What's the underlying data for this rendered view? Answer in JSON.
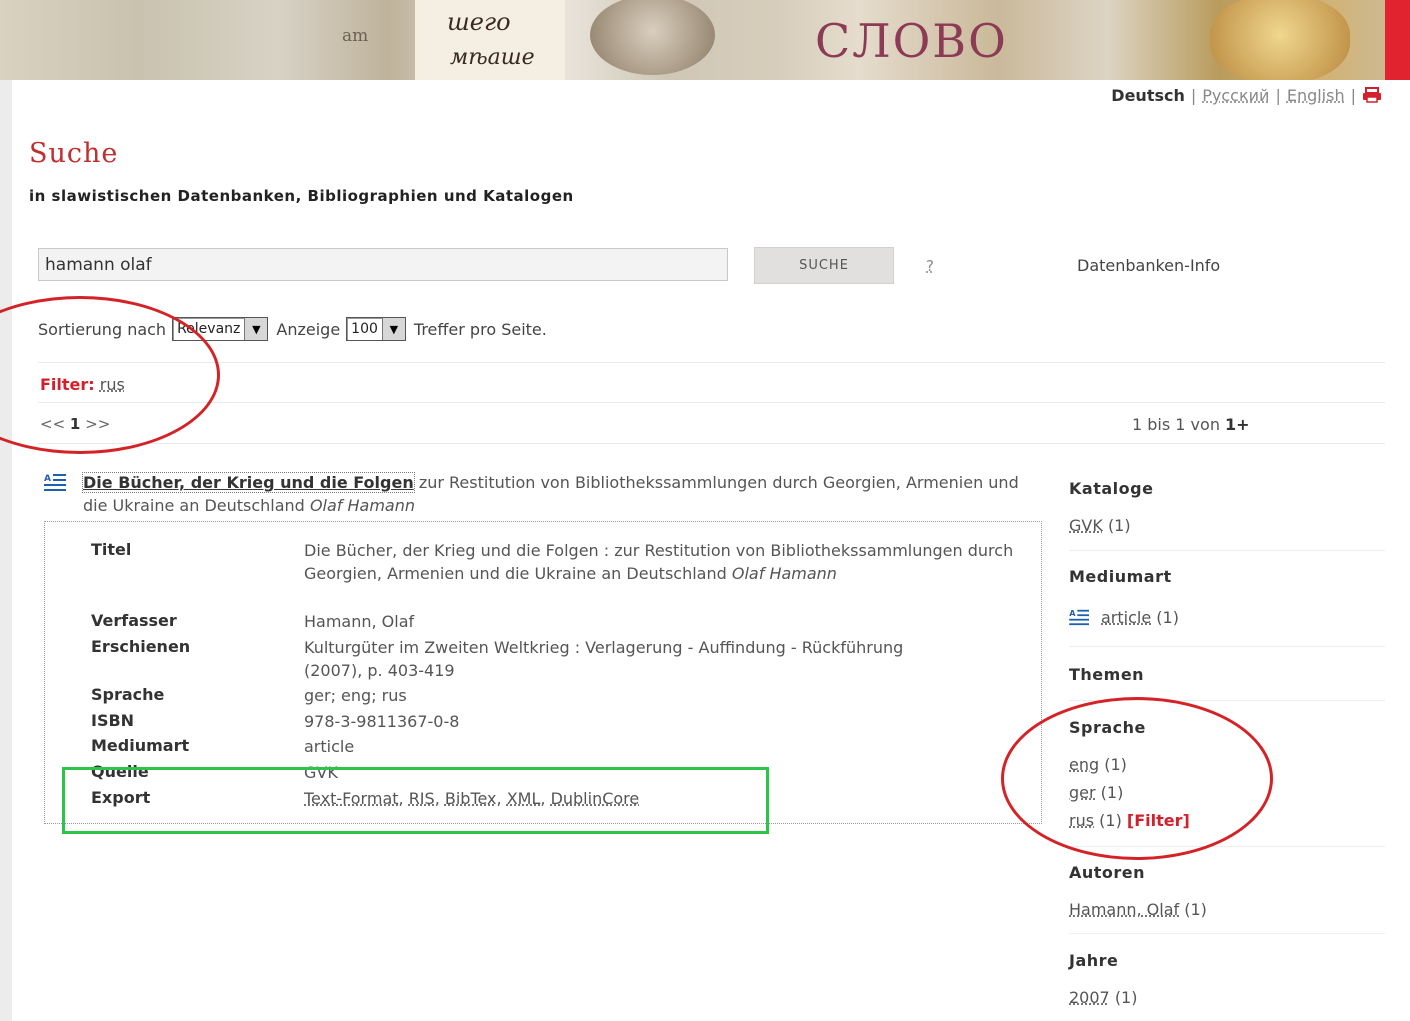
{
  "banner": {
    "colors": {
      "accent_red": "#e0232f"
    },
    "texts": [
      "шего",
      "мѣаше",
      "СЛОВО",
      "am"
    ]
  },
  "language_bar": {
    "items": [
      "Deutsch",
      "Русский",
      "English"
    ],
    "active": "Deutsch",
    "separator": "|",
    "print_icon": "printer-icon"
  },
  "page": {
    "title": "Suche",
    "subtitle": "in slawistischen Datenbanken, Bibliographien und Katalogen"
  },
  "search": {
    "value": "hamann olaf",
    "button_label": "SUCHE",
    "help_label": "?",
    "db_info_label": "Datenbanken-Info"
  },
  "sort": {
    "prefix": "Sortierung nach",
    "selected": "Relevanz",
    "display_label": "Anzeige",
    "per_page": "100",
    "suffix": "Treffer pro Seite."
  },
  "filter": {
    "label": "Filter:",
    "value": "rus"
  },
  "pager": {
    "prev": "<<",
    "current": "1",
    "next": ">>"
  },
  "results_count": {
    "text": "1 bis 1 von",
    "total": "1+"
  },
  "result": {
    "title_link": "Die Bücher, der Krieg und die Folgen",
    "title_rest": "zur Restitution von Bibliothekssammlungen durch Georgien, Armenien und die Ukraine an Deutschland",
    "author_italic": "Olaf Hamann",
    "icon": "article-icon",
    "details": {
      "titel_label": "Titel",
      "titel_value": "Die Bücher, der Krieg und die Folgen : zur Restitution von Bibliothekssammlungen durch Georgien, Armenien und die Ukraine an Deutschland",
      "titel_author": "Olaf Hamann",
      "verfasser_label": "Verfasser",
      "verfasser_value": "Hamann, Olaf",
      "erschienen_label": "Erschienen",
      "erschienen_value": "Kulturgüter im Zweiten Weltkrieg : Verlagerung - Auffindung - Rückführung (2007), p. 403-419",
      "sprache_label": "Sprache",
      "sprache_value": "ger; eng; rus",
      "isbn_label": "ISBN",
      "isbn_value": "978-3-9811367-0-8",
      "mediumart_label": "Mediumart",
      "mediumart_value": "article",
      "quelle_label": "Quelle",
      "quelle_value": "GVK",
      "export_label": "Export",
      "export_formats": [
        "Text-Format",
        "RIS",
        "BibTex",
        "XML",
        "DublinCore"
      ]
    }
  },
  "facets": {
    "kataloge": {
      "heading": "Kataloge",
      "items": [
        {
          "label": "GVK",
          "count": "(1)"
        }
      ]
    },
    "mediumart": {
      "heading": "Mediumart",
      "items": [
        {
          "label": "article",
          "count": "(1)"
        }
      ]
    },
    "themen": {
      "heading": "Themen"
    },
    "sprache": {
      "heading": "Sprache",
      "items": [
        {
          "label": "eng",
          "count": "(1)"
        },
        {
          "label": "ger",
          "count": "(1)"
        },
        {
          "label": "rus",
          "count": "(1)",
          "filter_text": "Filter"
        }
      ]
    },
    "autoren": {
      "heading": "Autoren",
      "items": [
        {
          "label": "Hamann, Olaf",
          "count": "(1)"
        }
      ]
    },
    "jahre": {
      "heading": "Jahre",
      "items": [
        {
          "label": "2007",
          "count": "(1)"
        }
      ]
    }
  },
  "annotations": {
    "ellipse_color": "#d42226",
    "box_color": "#2ec44a"
  }
}
